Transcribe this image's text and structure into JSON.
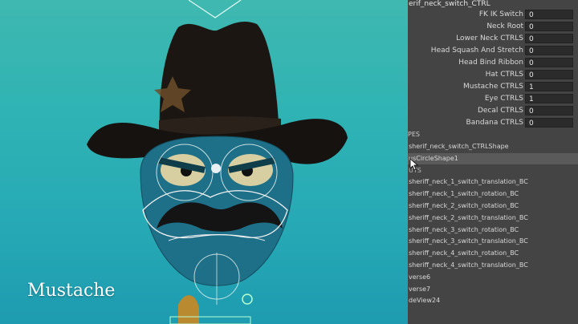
{
  "viewport": {
    "caption": "Mustache"
  },
  "channel_box": {
    "title": "erif_neck_switch_CTRL",
    "attributes": [
      {
        "label": "FK IK Switch",
        "value": "0"
      },
      {
        "label": "Neck Root",
        "value": "0"
      },
      {
        "label": "Lower Neck CTRLS",
        "value": "0"
      },
      {
        "label": "Head Squash And Stretch",
        "value": "0"
      },
      {
        "label": "Head Bind Ribbon",
        "value": "0"
      },
      {
        "label": "Hat CTRLS",
        "value": "0"
      },
      {
        "label": "Mustache CTRLS",
        "value": "1"
      },
      {
        "label": "Eye CTRLS",
        "value": "1"
      },
      {
        "label": "Decal CTRLS",
        "value": "0"
      },
      {
        "label": "Bandana CTRLS",
        "value": "0"
      }
    ],
    "shapes_header": "PES",
    "nodes": [
      {
        "label": "sherif_neck_switch_CTRLShape"
      },
      {
        "label": "usCircleShape1"
      },
      {
        "label": "UTS"
      },
      {
        "label": "sheriff_neck_1_switch_translation_BC"
      },
      {
        "label": "sheriff_neck_1_switch_rotation_BC"
      },
      {
        "label": "sheriff_neck_2_switch_rotation_BC"
      },
      {
        "label": "sheriff_neck_2_switch_translation_BC"
      },
      {
        "label": "sheriff_neck_3_switch_rotation_BC"
      },
      {
        "label": "sheriff_neck_3_switch_translation_BC"
      },
      {
        "label": "sheriff_neck_4_switch_rotation_BC"
      },
      {
        "label": "sheriff_neck_4_switch_translation_BC"
      },
      {
        "label": "verse6"
      },
      {
        "label": "verse7"
      },
      {
        "label": "deView24"
      }
    ]
  },
  "colors": {
    "viewport_bg": "#2fb3b4",
    "panel_bg": "#444444",
    "field_bg": "#2b2b2b",
    "selected_row": "#5a5a5a"
  }
}
